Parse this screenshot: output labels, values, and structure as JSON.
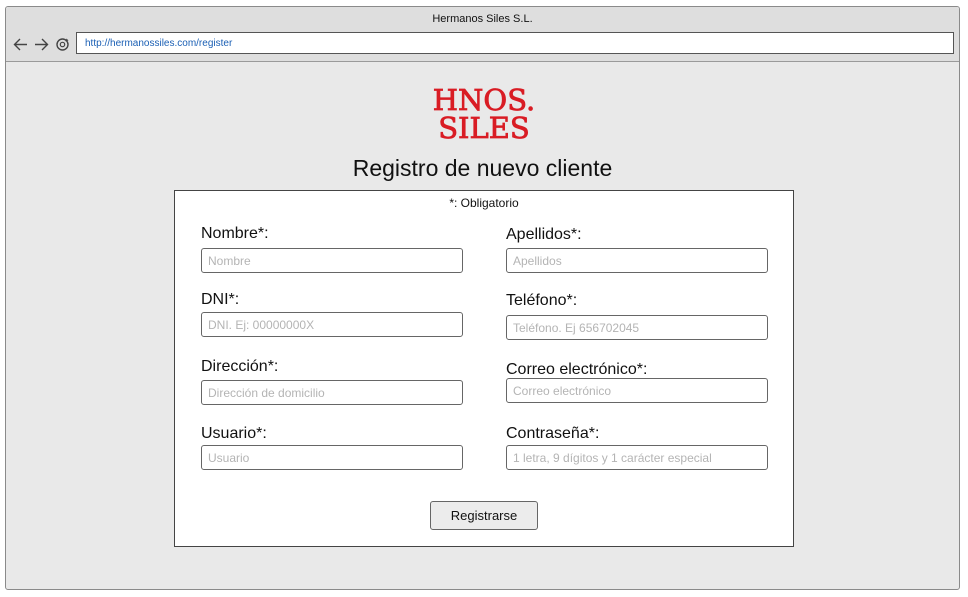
{
  "window": {
    "title": "Hermanos Siles S.L."
  },
  "browser": {
    "url": "http://hermanossiles.com/register",
    "icons": [
      "back-arrow-icon",
      "forward-arrow-icon",
      "reload-icon"
    ]
  },
  "logo": {
    "line1": "HNOS.",
    "line2": "SILES",
    "color": "#d91c24"
  },
  "page": {
    "title": "Registro de nuevo cliente"
  },
  "form": {
    "required_note": "*: Obligatorio",
    "fields": {
      "nombre": {
        "label": "Nombre*:",
        "placeholder": "Nombre"
      },
      "apellidos": {
        "label": "Apellidos*:",
        "placeholder": "Apellidos"
      },
      "dni": {
        "label": "DNI*:",
        "placeholder": "DNI. Ej: 00000000X"
      },
      "telefono": {
        "label": "Teléfono*:",
        "placeholder": "Teléfono. Ej 656702045"
      },
      "direccion": {
        "label": "Dirección*:",
        "placeholder": "Dirección de domicilio"
      },
      "correo": {
        "label": "Correo electrónico*:",
        "placeholder": "Correo electrónico"
      },
      "usuario": {
        "label": "Usuario*:",
        "placeholder": "Usuario"
      },
      "contrasena": {
        "label": "Contraseña*:",
        "placeholder": "1 letra, 9 dígitos y 1 carácter especial"
      }
    },
    "submit_label": "Registrarse"
  }
}
